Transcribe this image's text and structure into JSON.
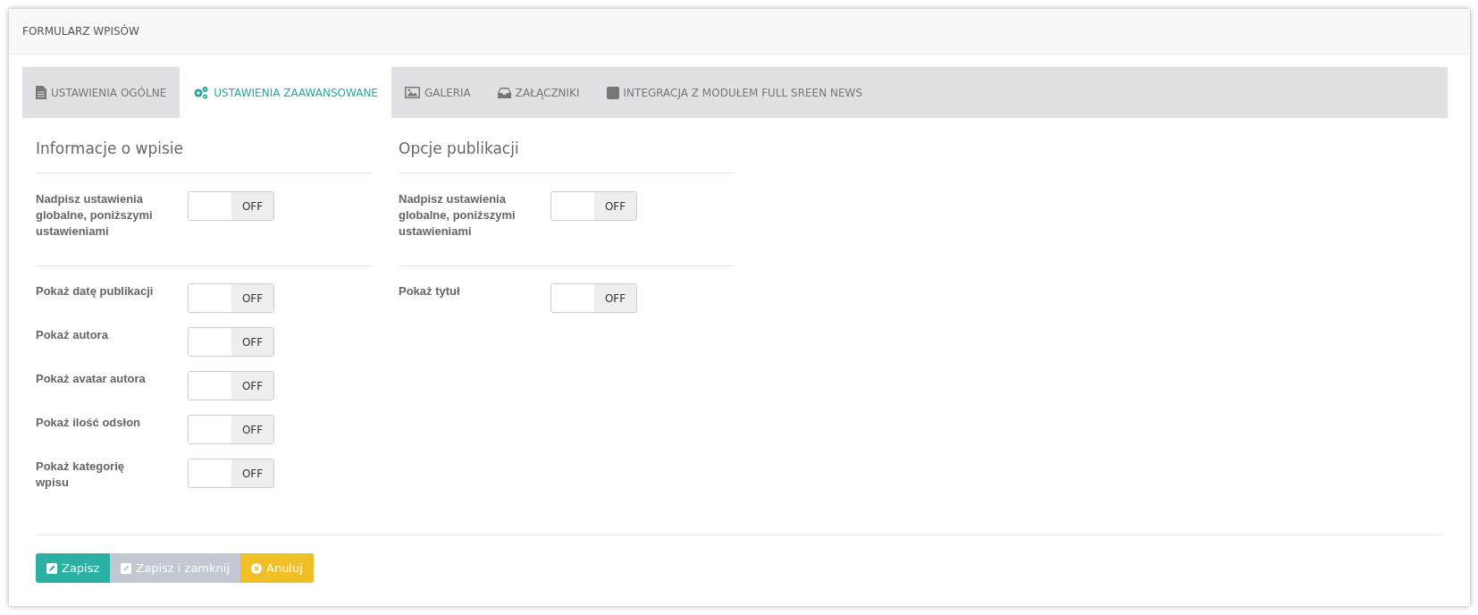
{
  "panel": {
    "title": "FORMULARZ WPISÓW"
  },
  "tabs": [
    {
      "label": "USTAWIENIA OGÓLNE",
      "selected": false
    },
    {
      "label": "USTAWIENIA ZAAWANSOWANE",
      "selected": true
    },
    {
      "label": "GALERIA",
      "selected": false
    },
    {
      "label": "ZAŁĄCZNIKI",
      "selected": false
    },
    {
      "label": "INTEGRACJA Z MODUŁEM FULL SREEN NEWS",
      "selected": false
    }
  ],
  "sections": [
    {
      "title": "Informacje o wpisie",
      "groups": [
        [
          {
            "label": "Nadpisz ustawienia globalne, poniższymi ustawieniami",
            "state": "OFF",
            "on": false
          }
        ],
        [
          {
            "label": "Pokaż datę publikacji",
            "state": "OFF",
            "on": false
          },
          {
            "label": "Pokaż autora",
            "state": "OFF",
            "on": false
          },
          {
            "label": "Pokaż avatar autora",
            "state": "OFF",
            "on": false
          },
          {
            "label": "Pokaż ilość odsłon",
            "state": "OFF",
            "on": false
          },
          {
            "label": "Pokaż kategorię wpisu",
            "state": "OFF",
            "on": false
          }
        ]
      ]
    },
    {
      "title": "Opcje publikacji",
      "groups": [
        [
          {
            "label": "Nadpisz ustawienia globalne, poniższymi ustawieniami",
            "state": "OFF",
            "on": false
          }
        ],
        [
          {
            "label": "Pokaż tytuł",
            "state": "OFF",
            "on": false
          }
        ]
      ]
    }
  ],
  "buttons": [
    {
      "label": "Zapisz",
      "kind": "save"
    },
    {
      "label": "Zapisz i zamknij",
      "kind": "save-close"
    },
    {
      "label": "Anuluj",
      "kind": "cancel"
    }
  ]
}
